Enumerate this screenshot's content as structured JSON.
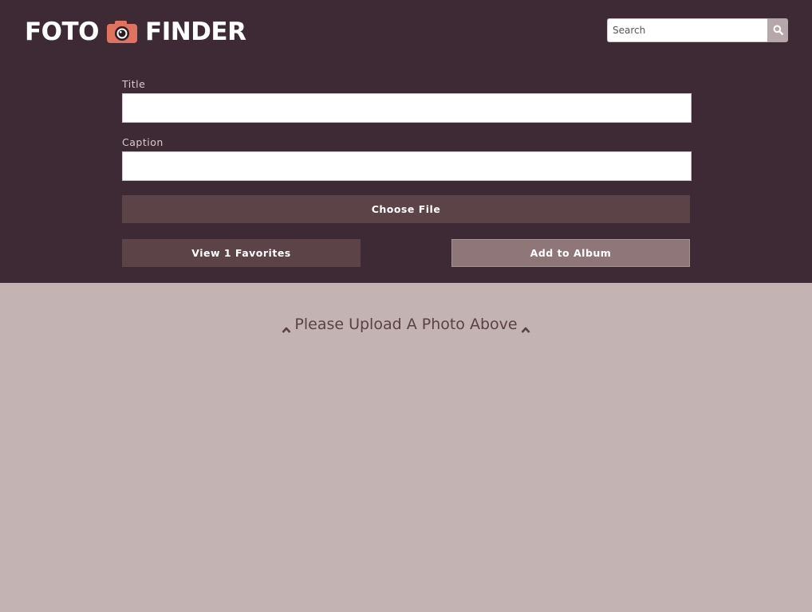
{
  "header": {
    "logo": {
      "word_left": "FOTO",
      "word_right": "FINDER",
      "icon": "camera-icon"
    },
    "search": {
      "placeholder": "Search",
      "value": "",
      "icon": "search-icon"
    }
  },
  "form": {
    "title": {
      "label": "Title",
      "value": ""
    },
    "caption": {
      "label": "Caption",
      "value": ""
    },
    "choose_file_label": "Choose File",
    "view_favorites_label": "View 1 Favorites",
    "add_to_album_label": "Add to Album"
  },
  "main": {
    "notice": "Please Upload A Photo Above",
    "notice_icon": "chevron-up-icon"
  },
  "colors": {
    "header_bg": "#3d2a35",
    "page_bg": "#c3b3b3",
    "button_dark": "#5c4347",
    "button_light": "#8f7779",
    "camera_accent": "#e0735f"
  }
}
